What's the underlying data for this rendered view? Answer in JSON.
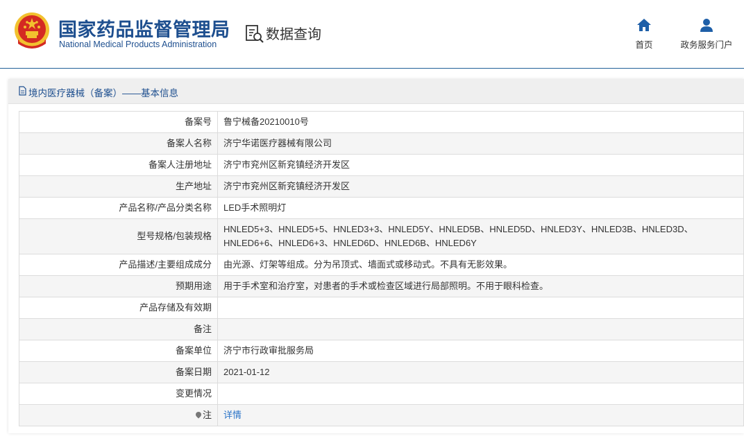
{
  "header": {
    "org_cn": "国家药品监督管理局",
    "org_en": "National Medical Products Administration",
    "section": "数据查询",
    "nav": [
      {
        "label": "首页",
        "icon": "home-icon"
      },
      {
        "label": "政务服务门户",
        "icon": "user-icon"
      }
    ]
  },
  "panel": {
    "title": "境内医疗器械（备案）——基本信息"
  },
  "record": {
    "rows": [
      {
        "label": "备案号",
        "value": "鲁宁械备20210010号"
      },
      {
        "label": "备案人名称",
        "value": "济宁华诺医疗器械有限公司"
      },
      {
        "label": "备案人注册地址",
        "value": "济宁市兖州区新兖镇经济开发区"
      },
      {
        "label": "生产地址",
        "value": "济宁市兖州区新兖镇经济开发区"
      },
      {
        "label": "产品名称/产品分类名称",
        "value": "LED手术照明灯"
      },
      {
        "label": "型号规格/包装规格",
        "value": "HNLED5+3、HNLED5+5、HNLED3+3、HNLED5Y、HNLED5B、HNLED5D、HNLED3Y、HNLED3B、HNLED3D、HNLED6+6、HNLED6+3、HNLED6D、HNLED6B、HNLED6Y"
      },
      {
        "label": "产品描述/主要组成成分",
        "value": "由光源、灯架等组成。分为吊顶式、墙面式或移动式。不具有无影效果。"
      },
      {
        "label": "预期用途",
        "value": "用于手术室和治疗室，对患者的手术或检查区域进行局部照明。不用于眼科检查。"
      },
      {
        "label": "产品存储及有效期",
        "value": ""
      },
      {
        "label": "备注",
        "value": ""
      },
      {
        "label": "备案单位",
        "value": "济宁市行政审批服务局"
      },
      {
        "label": "备案日期",
        "value": "2021-01-12"
      },
      {
        "label": "变更情况",
        "value": ""
      },
      {
        "label": "注",
        "value": "详情"
      }
    ]
  },
  "colors": {
    "brand_blue": "#1e4f8f",
    "link_blue": "#2a74c8",
    "emblem_red": "#d42a22",
    "emblem_gold": "#f2c12e"
  }
}
